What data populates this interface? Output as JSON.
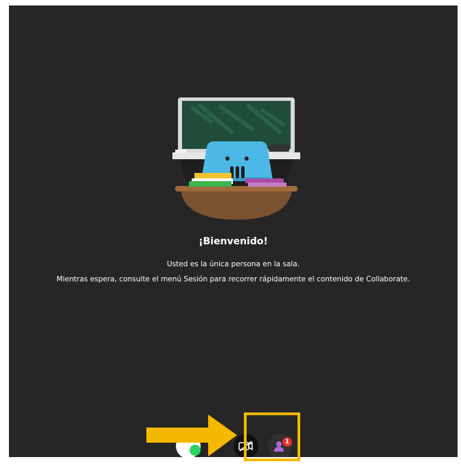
{
  "welcome": {
    "title": "¡Bienvenido!",
    "line1": "Usted es la única persona en la sala.",
    "line2": "Mientras espera, consulte el menú Sesión para recorrer rápidamente el contenido de Collaborate."
  },
  "controls": {
    "microphone_icon": "microphone-icon",
    "camera_icon": "camera-off-icon",
    "attendees_icon": "attendees-icon",
    "attendees_count": "1"
  },
  "annotations": {
    "arrow_color": "#f5b800",
    "highlight_color": "#f5b800"
  }
}
